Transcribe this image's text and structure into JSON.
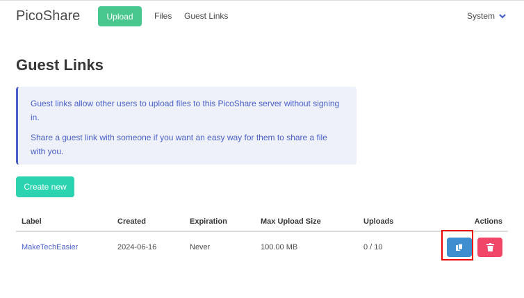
{
  "nav": {
    "brand": "PicoShare",
    "upload": "Upload",
    "files": "Files",
    "guest_links": "Guest Links",
    "system": "System"
  },
  "page": {
    "title": "Guest Links",
    "note": [
      "Guest links allow other users to upload files to this PicoShare server without signing in.",
      "Share a guest link with someone if you want an easy way for them to share a file with you."
    ],
    "create": "Create new"
  },
  "table": {
    "headers": [
      "Label",
      "Created",
      "Expiration",
      "Max Upload Size",
      "Uploads",
      "Actions"
    ],
    "rows": [
      {
        "label": "MakeTechEasier",
        "created": "2024-06-16",
        "expiration": "Never",
        "max_size": "100.00 MB",
        "uploads": "0 / 10"
      }
    ]
  },
  "colors": {
    "accent": "#485fc7",
    "upload": "#48c78e",
    "create": "#2bd3b0",
    "copy": "#3e8ed0",
    "delete": "#f14668"
  }
}
